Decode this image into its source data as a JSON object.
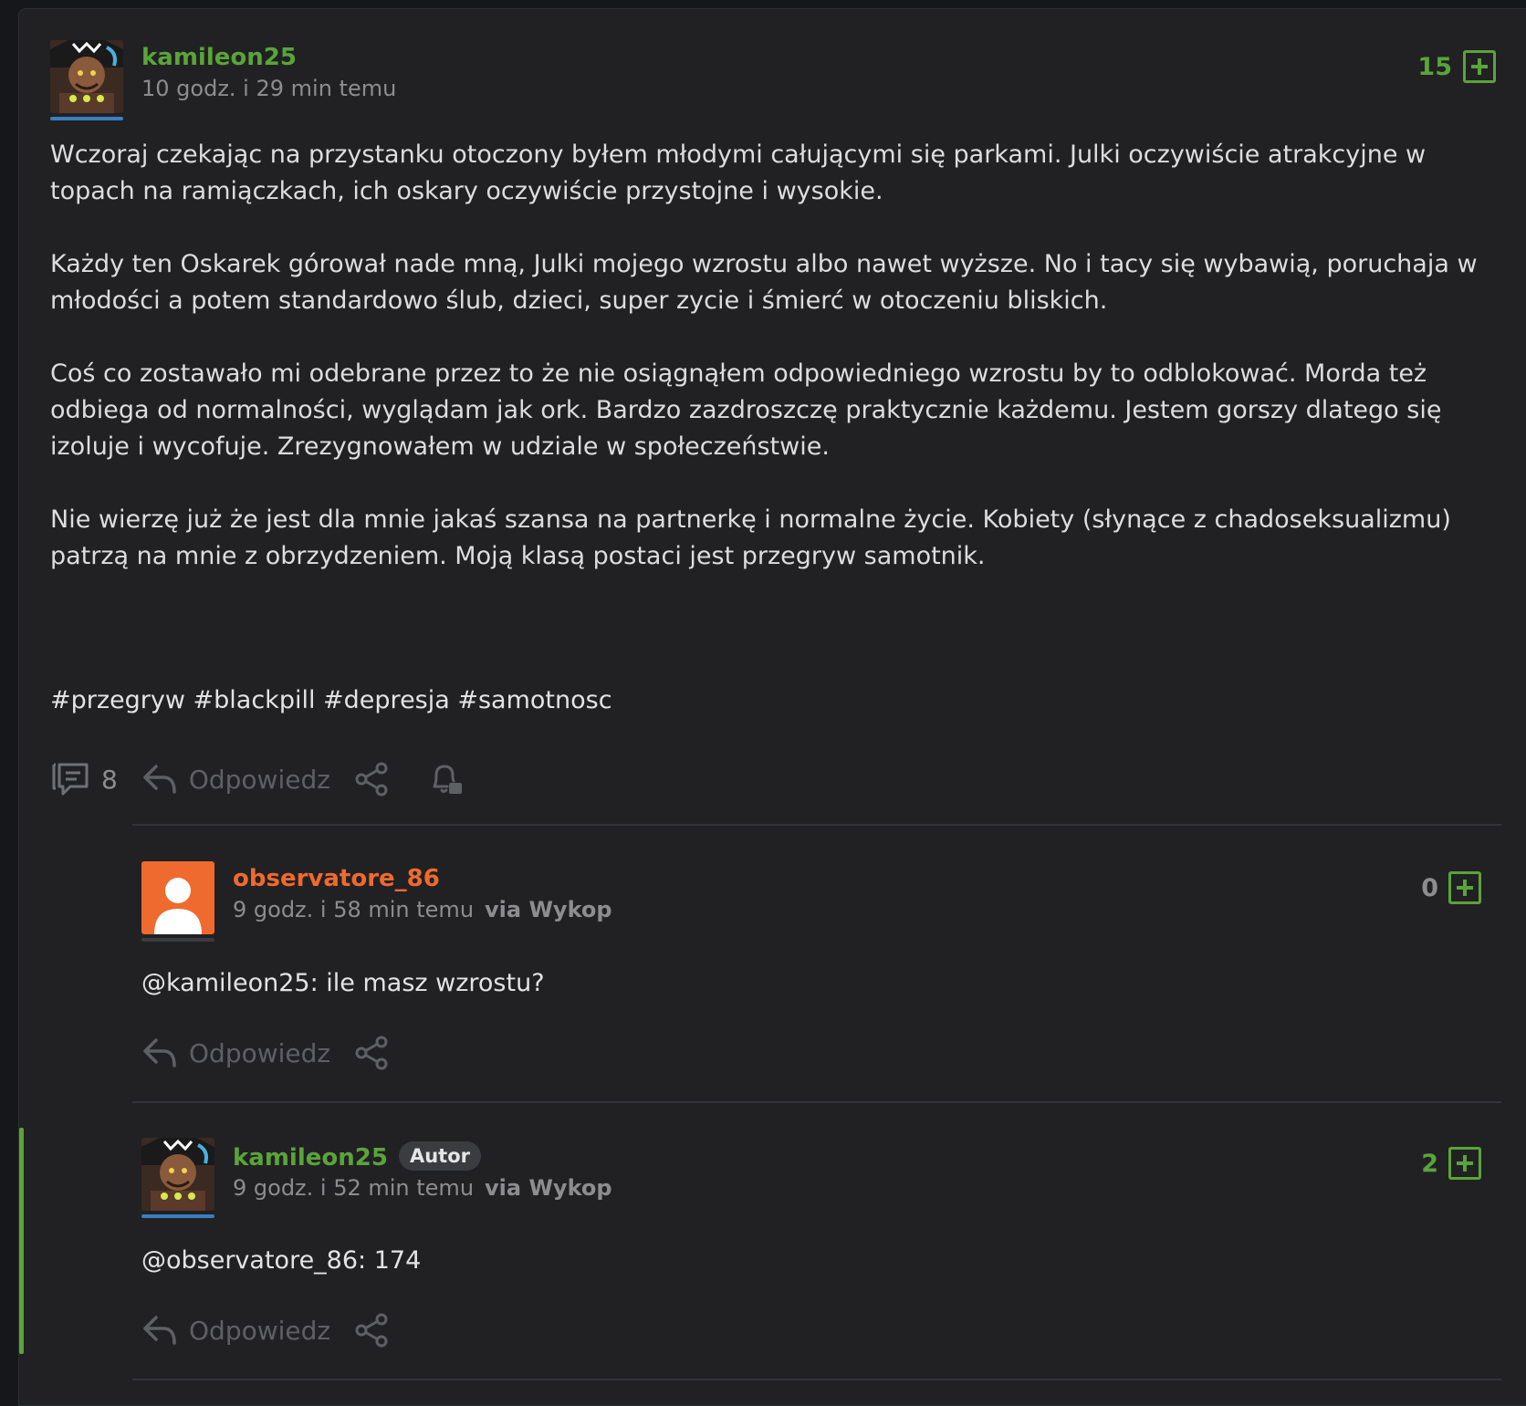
{
  "post": {
    "author": "kamileon25",
    "time": "10 godz. i 29 min temu",
    "score": "15",
    "paragraphs": [
      "Wczoraj czekając na przystanku otoczony byłem młodymi całującymi się parkami. Julki oczywiście atrakcyjne w topach na ramiączkach, ich oskary oczywiście przystojne i wysokie.",
      "Każdy ten Oskarek górował nade mną, Julki mojego wzrostu albo nawet wyższe. No i tacy się wybawią, poruchaja w młodości a potem standardowo ślub, dzieci, super zycie i śmierć w otoczeniu bliskich.",
      "Coś co zostawało mi odebrane przez to że nie osiągnąłem odpowiedniego wzrostu by to odblokować. Morda też odbiega od normalności, wyglądam jak ork. Bardzo zazdroszczę praktycznie każdemu. Jestem gorszy dlatego się izoluje i wycofuje. Zrezygnowałem w udziale w społeczeństwie.",
      "Nie wierzę już że jest dla mnie jakaś szansa na partnerkę i normalne życie. Kobiety (słynące z chadoseksualizmu) patrzą na mnie z obrzydzeniem. Moją klasą postaci jest przegryw samotnik."
    ],
    "tags": "#przegryw #blackpill #depresja #samotnosc",
    "comment_count": "8",
    "reply_label": "Odpowiedz"
  },
  "comments": [
    {
      "author": "observatore_86",
      "time": "9 godz. i 58 min temu",
      "via": "via Wykop",
      "score": "0",
      "text": "@kamileon25: ile masz wzrostu?",
      "reply_label": "Odpowiedz"
    },
    {
      "author": "kamileon25",
      "badge": "Autor",
      "time": "9 godz. i 52 min temu",
      "via": "via Wykop",
      "score": "2",
      "text": "@observatore_86: 174",
      "reply_label": "Odpowiedz"
    }
  ],
  "colors": {
    "background": "#212124",
    "username_green": "#5aa43a",
    "username_orange": "#ef6a2e",
    "muted": "#5f6064",
    "highlight_bar": "#5aa43a"
  },
  "icons": [
    "comment-icon",
    "reply-icon",
    "share-icon",
    "notify-bell-icon",
    "plus-vote-icon",
    "default-avatar-icon"
  ]
}
